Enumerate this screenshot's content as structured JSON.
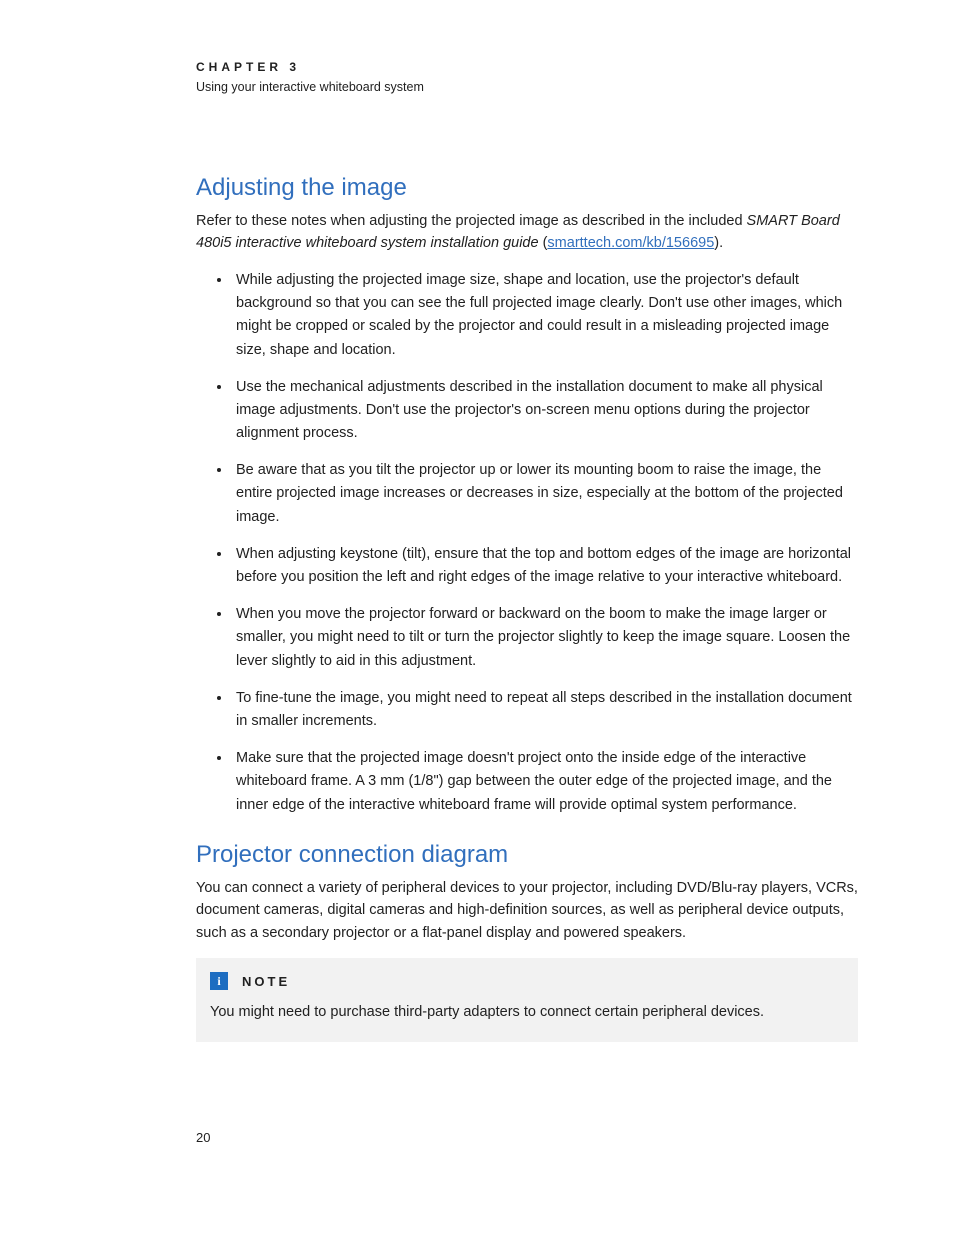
{
  "header": {
    "chapter": "CHAPTER 3",
    "subtitle": "Using your interactive whiteboard system"
  },
  "section1": {
    "title": "Adjusting the image",
    "intro_pre": "Refer to these notes when adjusting the projected image as described in the included ",
    "intro_em": "SMART Board 480i5 interactive whiteboard system installation guide",
    "intro_open": " (",
    "intro_link": "smarttech.com/kb/156695",
    "intro_close": ").",
    "bullets": [
      "While adjusting the projected image size, shape and location, use the projector's default background so that you can see the full projected image clearly. Don't use other images, which might be cropped or scaled by the projector and could result in a misleading projected image size, shape and location.",
      "Use the mechanical adjustments described in the installation document to make all physical image adjustments. Don't use the projector's on-screen menu options during the projector alignment process.",
      "Be aware that as you tilt the projector up or lower its mounting boom to raise the image, the entire projected image increases or decreases in size, especially at the bottom of the projected image.",
      "When adjusting keystone (tilt), ensure that the top and bottom edges of the image are horizontal before you position the left and right edges of the image relative to your interactive whiteboard.",
      "When you move the projector forward or backward on the boom to make the image larger or smaller, you might need to tilt or turn the projector slightly to keep the image square. Loosen the lever slightly to aid in this adjustment.",
      "To fine-tune the image, you might need to repeat all steps described in the installation document in smaller increments.",
      "Make sure that the projected image doesn't project onto the inside edge of the interactive whiteboard frame. A 3 mm (1/8\") gap between the outer edge of the projected image, and the inner edge of the interactive whiteboard frame will provide optimal system performance."
    ]
  },
  "section2": {
    "title": "Projector connection diagram",
    "intro": "You can connect a variety of peripheral devices to your projector, including DVD/Blu-ray players, VCRs, document cameras, digital cameras and high-definition sources, as well as peripheral device outputs, such as a secondary projector or a flat-panel display and powered speakers."
  },
  "note": {
    "icon": "i",
    "label": "NOTE",
    "body": "You might need to purchase third-party adapters to connect certain peripheral devices."
  },
  "page_number": "20"
}
